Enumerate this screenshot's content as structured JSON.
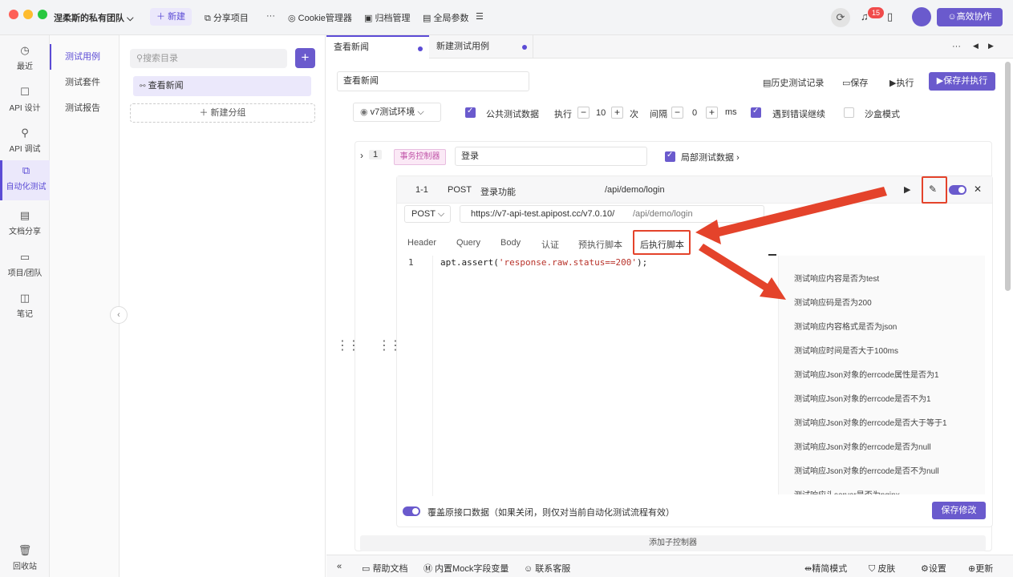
{
  "window": {
    "team_name": "涅柔斯的私有团队",
    "new_label": "新建",
    "share_label": "分享项目",
    "more_label": "···",
    "cookie_label": "Cookie管理器",
    "archive_label": "归档管理",
    "global_params_label": "全局参数",
    "notification_count": "15",
    "collab_label": "高效协作",
    "colors": {
      "accent": "#6a5acd",
      "highlight": "#e4432b"
    }
  },
  "leftnav": [
    {
      "label": "最近",
      "icon": "clock-icon"
    },
    {
      "label": "API 设计",
      "icon": "edit-icon"
    },
    {
      "label": "API 调试",
      "icon": "link-icon"
    },
    {
      "label": "自动化测试",
      "icon": "flow-icon"
    },
    {
      "label": "文档分享",
      "icon": "doc-icon"
    },
    {
      "label": "项目/团队",
      "icon": "folder-icon"
    },
    {
      "label": "笔记",
      "icon": "note-icon"
    },
    {
      "label": "回收站",
      "icon": "trash-icon"
    }
  ],
  "subnav": [
    "测试用例",
    "测试套件",
    "测试报告"
  ],
  "tree": {
    "search_placeholder": "搜索目录",
    "item": "查看新闻",
    "new_group": "新建分组"
  },
  "tabs": [
    "查看新闻",
    "新建测试用例"
  ],
  "tabbar_more": "···",
  "toolbar": {
    "case_name": "查看新闻",
    "history": "历史测试记录",
    "save": "保存",
    "run": "执行",
    "save_run": "保存并执行"
  },
  "options": {
    "env": "v7测试环境",
    "public_data": "公共测试数据",
    "run_label": "执行",
    "run_count": "10",
    "times_unit": "次",
    "interval_label": "间隔",
    "interval_value": "0",
    "ms_unit": "ms",
    "continue_on_error": "遇到错误继续",
    "sandbox": "沙盒模式"
  },
  "step": {
    "index": "1",
    "controller_tag": "事务控制器",
    "controller_name": "登录",
    "local_data": "局部测试数据",
    "api": {
      "index": "1-1",
      "method": "POST",
      "name": "登录功能",
      "path": "/api/demo/login",
      "base_url": "https://v7-api-test.apipost.cc/v7.0.10/",
      "url_path": "/api/demo/login",
      "subtabs": [
        "Header",
        "Query",
        "Body",
        "认证",
        "预执行脚本",
        "后执行脚本"
      ],
      "code_line_no": "1",
      "code_prefix": "apt.assert(",
      "code_string": "'response.raw.status==200'",
      "code_suffix": ");",
      "snippets": [
        "测试响应内容是否为test",
        "测试响应码是否为200",
        "测试响应内容格式是否为json",
        "测试响应时间是否大于100ms",
        "测试响应Json对象的errcode属性是否为1",
        "测试响应Json对象的errcode是否不为1",
        "测试响应Json对象的errcode是否大于等于1",
        "测试响应Json对象的errcode是否为null",
        "测试响应Json对象的errcode是否不为null",
        "测试响应头server是否为nginx"
      ],
      "override_label": "覆盖原接口数据（如果关闭，则仅对当前自动化测试流程有效）",
      "save_changes": "保存修改"
    },
    "add_sub": "添加子控制器"
  },
  "footer": {
    "help": "帮助文档",
    "mock": "内置Mock字段变量",
    "support": "联系客服",
    "simple_mode": "精简模式",
    "skin": "皮肤",
    "settings": "设置",
    "update": "更新"
  }
}
